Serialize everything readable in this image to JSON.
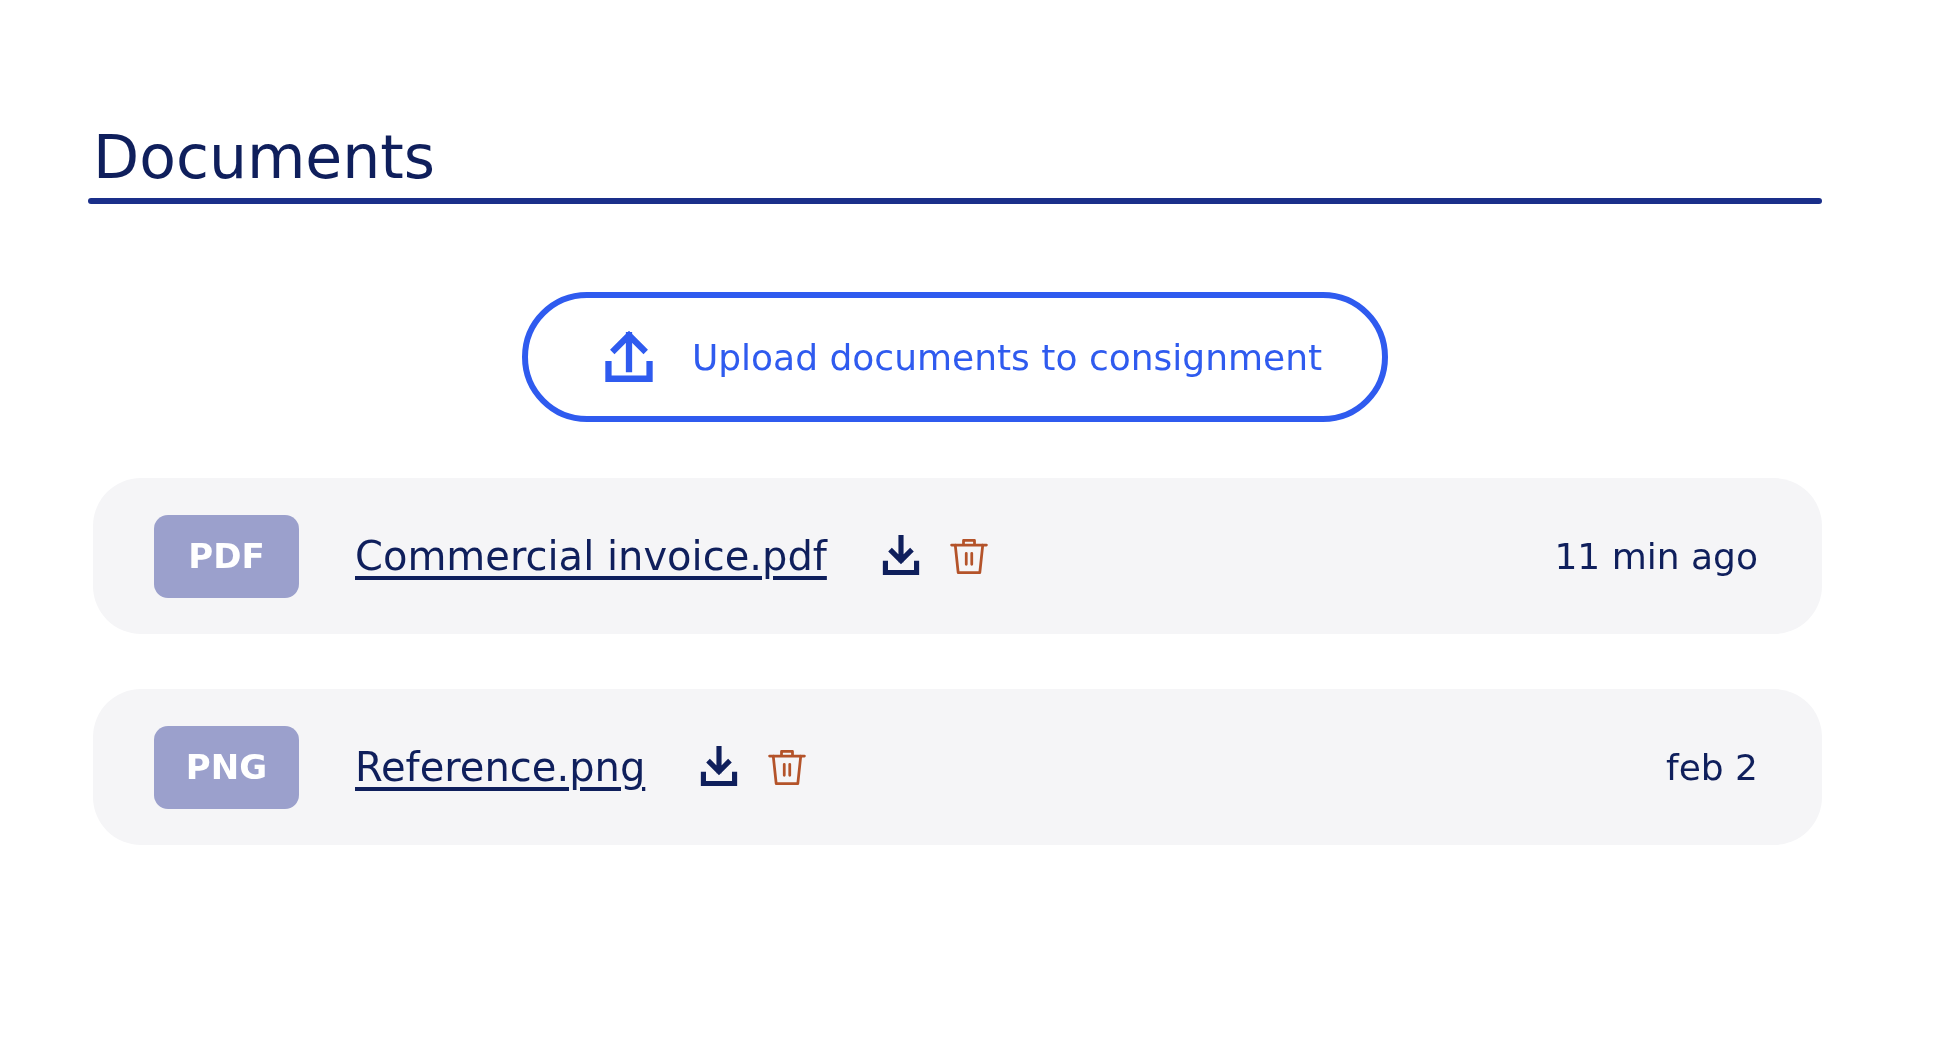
{
  "title": "Documents",
  "upload_button": {
    "label": "Upload documents to consignment"
  },
  "documents": [
    {
      "type_badge": "PDF",
      "name": "Commercial invoice.pdf",
      "time": "11 min ago"
    },
    {
      "type_badge": "PNG",
      "name": "Reference.png",
      "time": "feb 2"
    }
  ]
}
